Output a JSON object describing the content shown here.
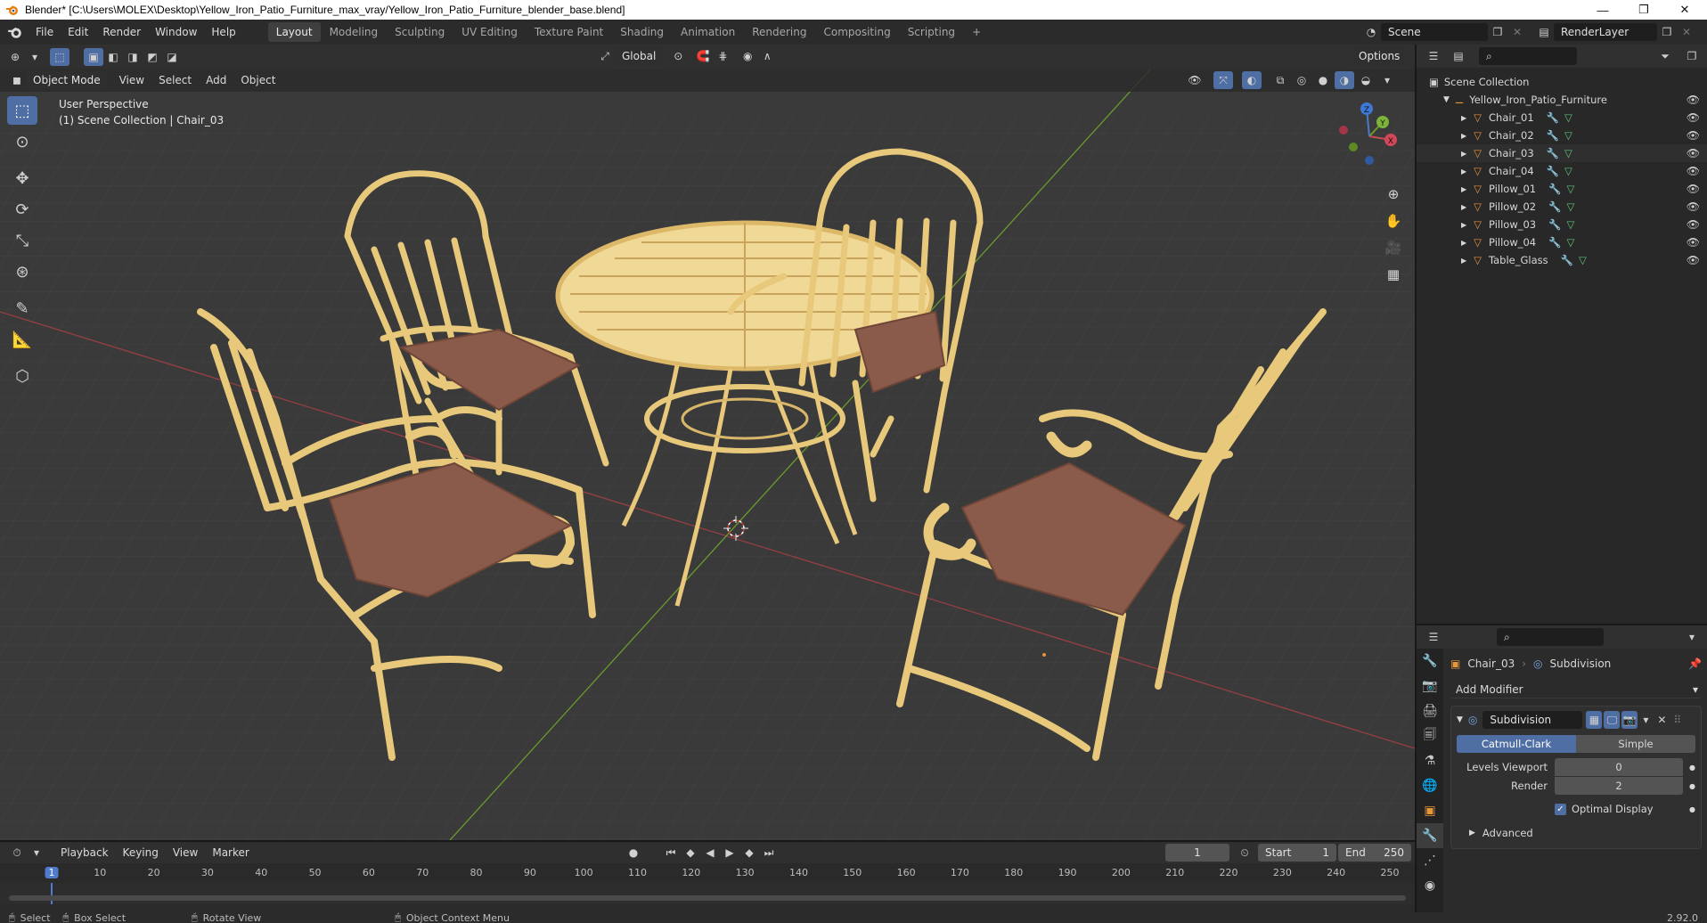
{
  "window": {
    "title": "Blender* [C:\\Users\\MOLEX\\Desktop\\Yellow_Iron_Patio_Furniture_max_vray/Yellow_Iron_Patio_Furniture_blender_base.blend]",
    "minimize": "—",
    "restore": "❐",
    "close": "✕"
  },
  "menus": [
    "File",
    "Edit",
    "Render",
    "Window",
    "Help"
  ],
  "workspaces": [
    "Layout",
    "Modeling",
    "Sculpting",
    "UV Editing",
    "Texture Paint",
    "Shading",
    "Animation",
    "Rendering",
    "Compositing",
    "Scripting"
  ],
  "active_workspace": "Layout",
  "add_workspace": "+",
  "scene_field": "Scene",
  "render_layer_field": "RenderLayer",
  "viewport": {
    "transform_orientation": "Global",
    "options_label": "Options",
    "mode_label": "Object Mode",
    "header_menus": [
      "View",
      "Select",
      "Add",
      "Object"
    ],
    "perspective_label": "User Perspective",
    "collection_label": "(1) Scene Collection | Chair_03",
    "gizmo_axes": {
      "x": "X",
      "y": "Y",
      "z": "Z"
    }
  },
  "outliner": {
    "root": "Scene Collection",
    "collection": "Yellow_Iron_Patio_Furniture",
    "items": [
      {
        "name": "Chair_01",
        "selected": false
      },
      {
        "name": "Chair_02",
        "selected": false
      },
      {
        "name": "Chair_03",
        "selected": true
      },
      {
        "name": "Chair_04",
        "selected": false
      },
      {
        "name": "Pillow_01",
        "selected": false
      },
      {
        "name": "Pillow_02",
        "selected": false
      },
      {
        "name": "Pillow_03",
        "selected": false
      },
      {
        "name": "Pillow_04",
        "selected": false
      },
      {
        "name": "Table_Glass",
        "selected": false
      }
    ]
  },
  "properties": {
    "object_name": "Chair_03",
    "modifier_context": "Subdivision",
    "add_modifier": "Add Modifier",
    "modifier_name": "Subdivision",
    "algo_options": [
      "Catmull-Clark",
      "Simple"
    ],
    "algo_selected": "Catmull-Clark",
    "levels_viewport_label": "Levels Viewport",
    "levels_viewport_value": "0",
    "render_label": "Render",
    "render_value": "2",
    "optimal_display_label": "Optimal Display",
    "optimal_display_checked": true,
    "advanced_label": "Advanced"
  },
  "timeline": {
    "menus": [
      "Playback",
      "Keying",
      "View",
      "Marker"
    ],
    "current_frame": "1",
    "start_label": "Start",
    "start_value": "1",
    "end_label": "End",
    "end_value": "250",
    "ruler": [
      "1",
      "10",
      "20",
      "30",
      "40",
      "50",
      "60",
      "70",
      "80",
      "90",
      "100",
      "110",
      "120",
      "130",
      "140",
      "150",
      "160",
      "170",
      "180",
      "190",
      "200",
      "210",
      "220",
      "230",
      "240",
      "250"
    ]
  },
  "statusbar": {
    "select": "Select",
    "box_select": "Box Select",
    "rotate_view": "Rotate View",
    "context_menu": "Object Context Menu",
    "version": "2.92.0"
  },
  "colors": {
    "accent": "#4f6ea3",
    "object_orange": "#e5953a",
    "furniture": "#e8c87a",
    "cushion": "#8a5b4b",
    "grid": "#444444",
    "x_axis": "#9a3f44",
    "y_axis": "#6a9b2d"
  }
}
